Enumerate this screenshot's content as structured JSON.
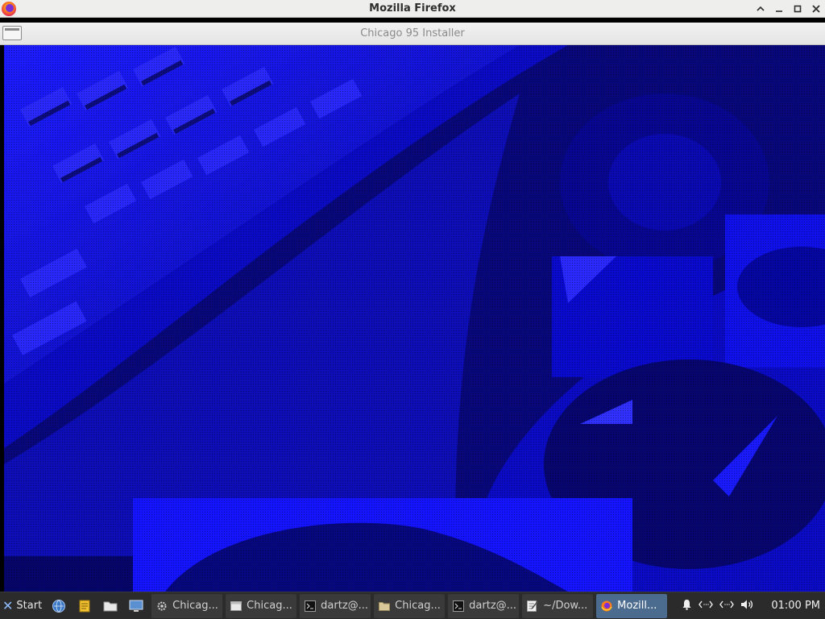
{
  "browser": {
    "title": "Mozilla Firefox"
  },
  "app": {
    "title": "Chicago 95 Installer"
  },
  "taskbar": {
    "start_label": "Start",
    "tasks": [
      {
        "label": "Chicag...",
        "icon": "settings-icon",
        "active": false
      },
      {
        "label": "Chicag...",
        "icon": "window-icon",
        "active": false
      },
      {
        "label": "dartz@...",
        "icon": "terminal-icon",
        "active": false
      },
      {
        "label": "Chicag...",
        "icon": "folder-icon",
        "active": false
      },
      {
        "label": "dartz@...",
        "icon": "terminal-icon",
        "active": false
      },
      {
        "label": "~/Dow...",
        "icon": "text-editor-icon",
        "active": false
      },
      {
        "label": "Mozill...",
        "icon": "firefox-icon",
        "active": true
      }
    ],
    "clock": "01:00 PM"
  },
  "colors": {
    "installer_blue": "#0d0dd8",
    "taskbar_bg": "#2b2b2b",
    "active_task": "#4b6b8f"
  }
}
